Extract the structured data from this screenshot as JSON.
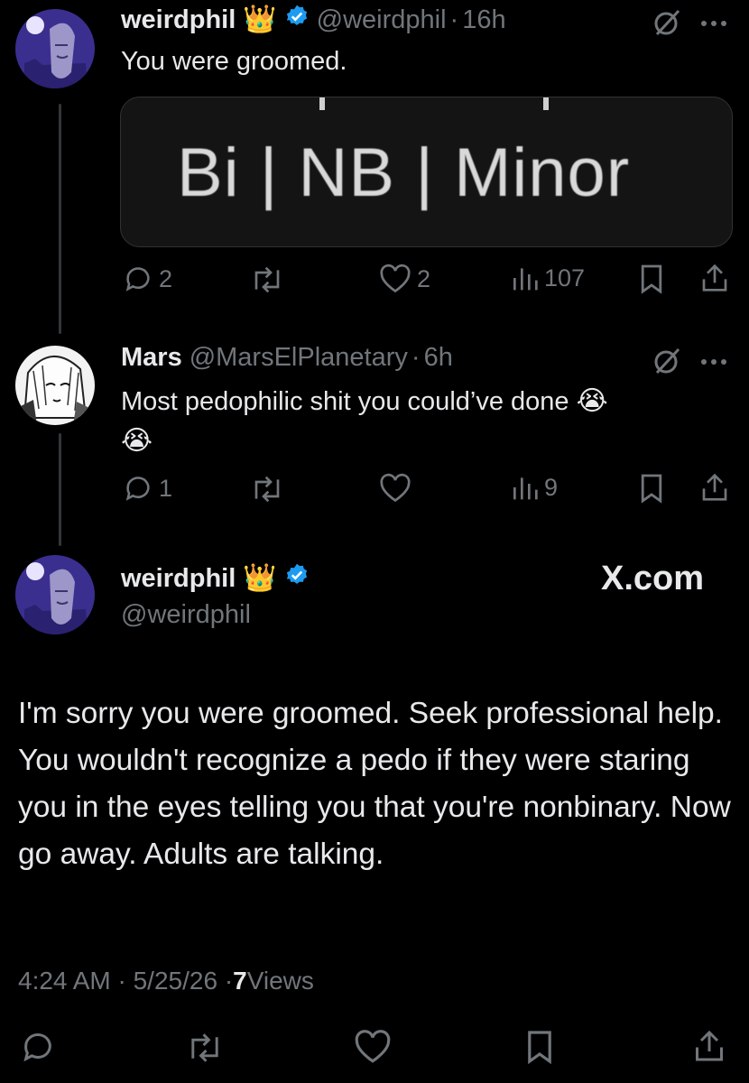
{
  "tweet1": {
    "name": "weirdphil",
    "handle": "@weirdphil",
    "time": "16h",
    "text": "You were groomed.",
    "media_text": "Bi | NB | Minor",
    "replies": "2",
    "likes": "2",
    "views": "107"
  },
  "tweet2": {
    "name": "Mars",
    "handle": "@MarsElPlanetary",
    "time": "6h",
    "text": "Most pedophilic shit you could’ve done",
    "replies": "1",
    "views": "9"
  },
  "main_tweet": {
    "name": "weirdphil",
    "handle": "@weirdphil",
    "brand": "X.com",
    "text": "I'm sorry you were groomed. Seek professional help. You wouldn't recognize a pedo if they were staring you in the eyes telling you that you're nonbinary. Now go away. Adults are talking.",
    "timestamp": "4:24 AM · 5/25/26 · ",
    "views_count": "7",
    "views_label": " Views"
  },
  "separator": "·",
  "colors": {
    "background": "#000000",
    "text": "#e7e9ea",
    "muted": "#71767b",
    "verified": "#1d9bf0"
  },
  "icons": [
    "reply-icon",
    "retweet-icon",
    "like-icon",
    "views-icon",
    "bookmark-icon",
    "share-icon",
    "more-icon",
    "grok-icon",
    "verified-badge-icon",
    "crown-emoji",
    "crying-emoji"
  ]
}
